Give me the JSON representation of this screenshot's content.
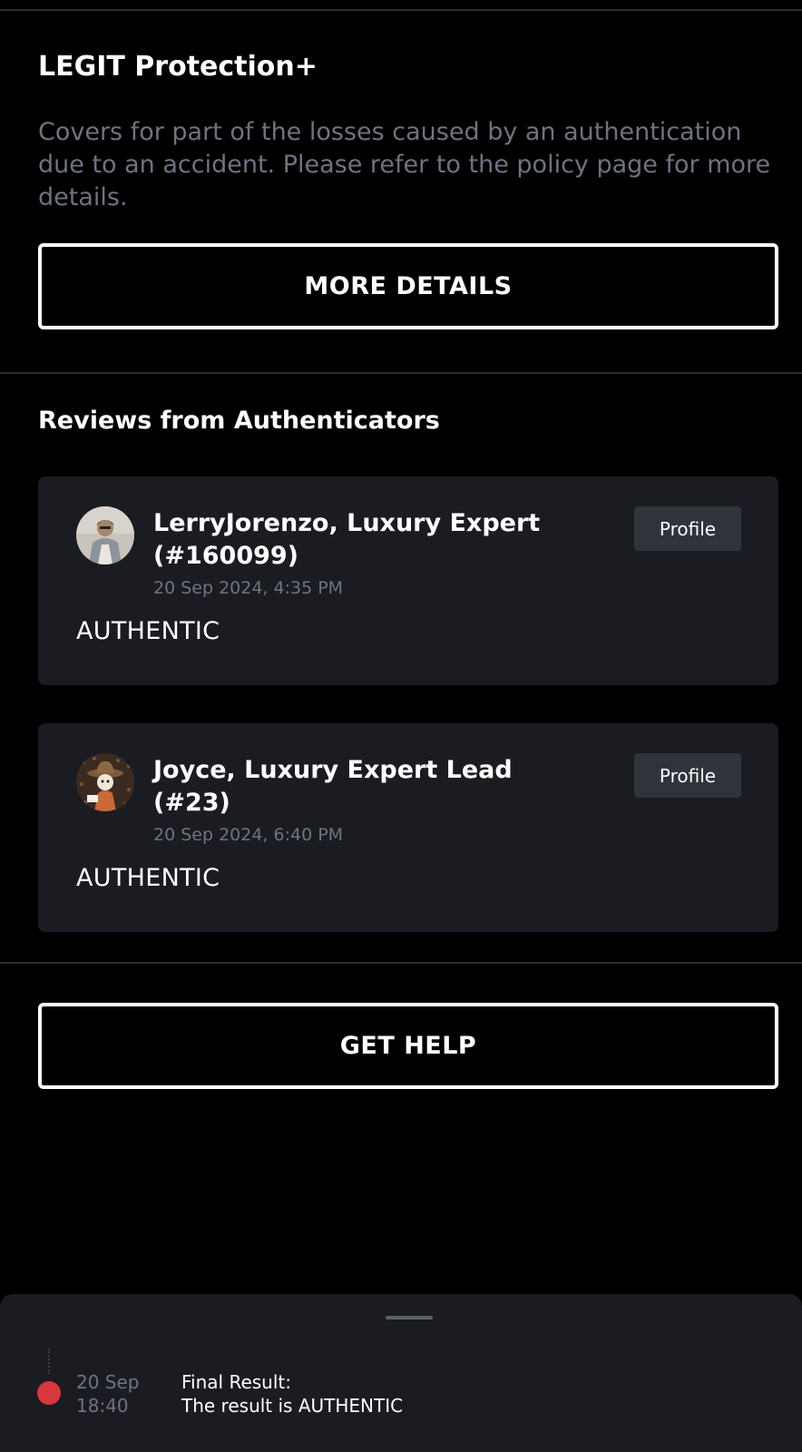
{
  "protection": {
    "title": "LEGIT Protection+",
    "description": "Covers for part of the losses caused by an authentication due to an accident. Please refer to the policy page for more details.",
    "more_details_label": "MORE DETAILS"
  },
  "reviews": {
    "title": "Reviews from Authenticators",
    "items": [
      {
        "name": "LerryJorenzo, Luxury Expert (#160099)",
        "date": "20 Sep 2024, 4:35 PM",
        "verdict": "AUTHENTIC",
        "profile_label": "Profile",
        "avatar_icon": "person-photo-avatar"
      },
      {
        "name": "Joyce, Luxury Expert Lead (#23)",
        "date": "20 Sep 2024, 6:40 PM",
        "verdict": "AUTHENTIC",
        "profile_label": "Profile",
        "avatar_icon": "cartoon-cowboy-avatar"
      }
    ]
  },
  "help": {
    "label": "GET HELP"
  },
  "timeline": {
    "date": "20 Sep",
    "time": "18:40",
    "event_title": "Final Result:",
    "event_detail": "The result is AUTHENTIC",
    "status_color": "#d9363e"
  },
  "colors": {
    "background": "#000000",
    "card": "#1b1c21",
    "muted_text": "#6f7380",
    "profile_button": "#30333b"
  }
}
